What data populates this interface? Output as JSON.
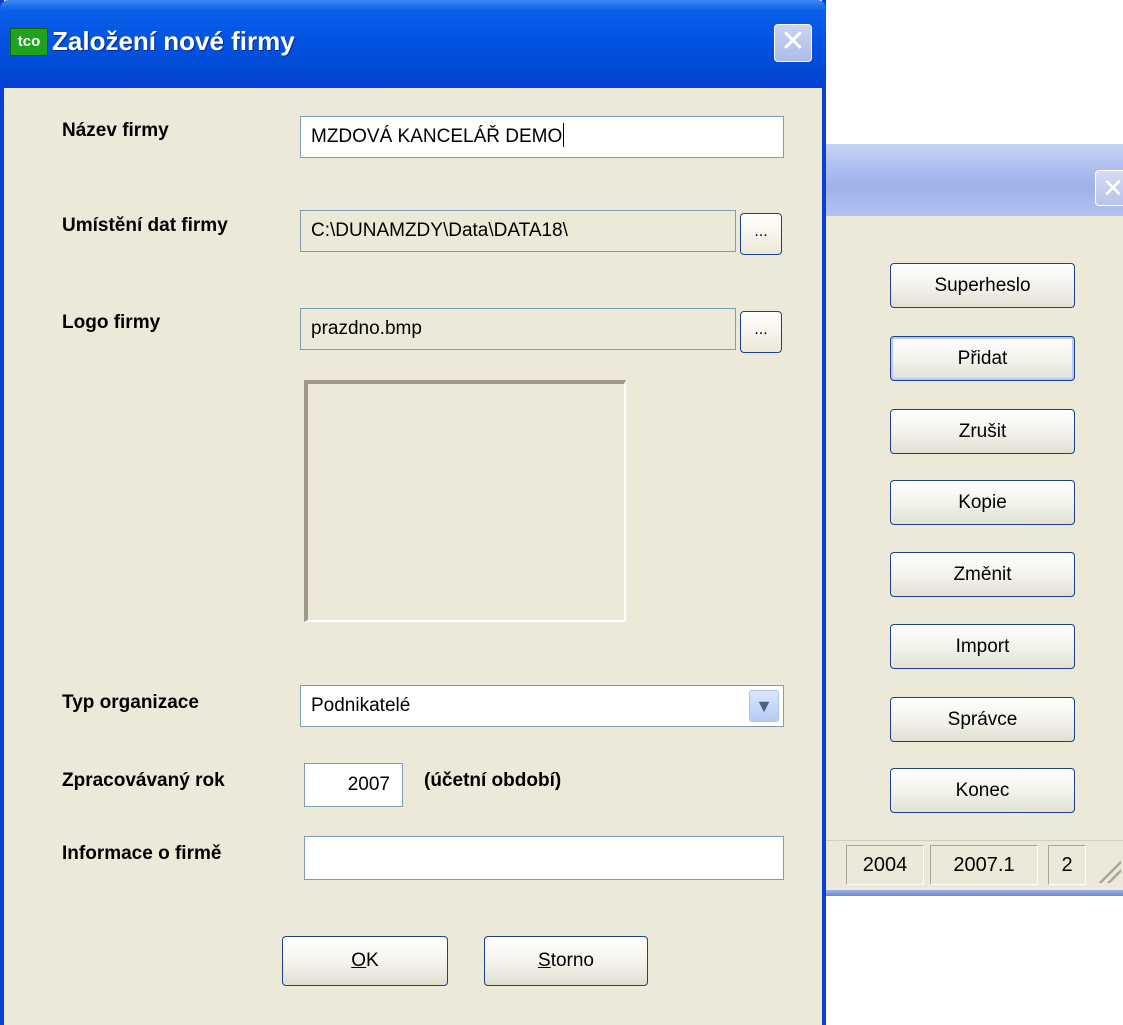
{
  "dialog": {
    "title": "Založení nové firmy",
    "app_icon_text": "tco",
    "close_symbol": "✕",
    "fields": {
      "name": {
        "label": "Název firmy",
        "value": "MZDOVÁ KANCELÁŘ DEMO"
      },
      "data_location": {
        "label": "Umístění dat firmy",
        "value": "C:\\DUNAMZDY\\Data\\DATA18\\",
        "browse_label": "..."
      },
      "logo": {
        "label": "Logo firmy",
        "value": "prazdno.bmp",
        "browse_label": "..."
      },
      "org_type": {
        "label": "Typ organizace",
        "value": "Podnikatelé"
      },
      "year": {
        "label": "Zpracovávaný rok",
        "value": "2007",
        "note": "(účetní období)"
      },
      "info": {
        "label": "Informace o firmě",
        "value": ""
      }
    },
    "buttons": {
      "ok": {
        "mnemonic": "O",
        "rest": "K"
      },
      "cancel": {
        "mnemonic": "S",
        "rest": "torno"
      }
    }
  },
  "background_window": {
    "close_symbol": "✕",
    "buttons": [
      "Superheslo",
      "Přidat",
      "Zrušit",
      "Kopie",
      "Změnit",
      "Import",
      "Správce",
      "Konec"
    ],
    "status": [
      "2004",
      "2007.1",
      "2"
    ]
  }
}
